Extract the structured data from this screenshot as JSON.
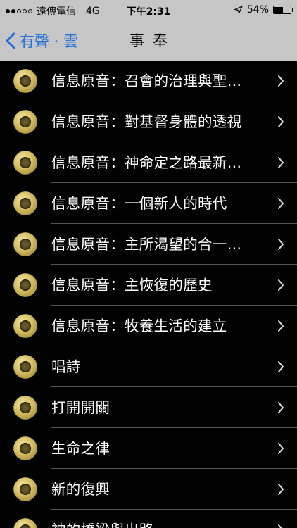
{
  "status_bar": {
    "carrier": "遠傳電信",
    "network": "4G",
    "time": "下午2:31",
    "battery_percent": "54%",
    "battery_level": 0.54,
    "signal_bars_filled": 2,
    "signal_bars_total": 5,
    "location_icon": "location-arrow-icon"
  },
  "nav": {
    "back_label": "有聲 · 雲",
    "title": "事奉",
    "accent_color": "#1e6fd9"
  },
  "list": {
    "items": [
      {
        "label": "信息原音：召會的治理與聖…"
      },
      {
        "label": "信息原音：對基督身體的透視"
      },
      {
        "label": "信息原音：神命定之路最新…"
      },
      {
        "label": "信息原音：一個新人的時代"
      },
      {
        "label": "信息原音：主所渴望的合一…"
      },
      {
        "label": "信息原音：主恢復的歷史"
      },
      {
        "label": "信息原音：牧養生活的建立"
      },
      {
        "label": "唱詩"
      },
      {
        "label": "打開開關"
      },
      {
        "label": "生命之律"
      },
      {
        "label": "新的復興"
      },
      {
        "label": "神的橋梁與出路"
      }
    ]
  }
}
